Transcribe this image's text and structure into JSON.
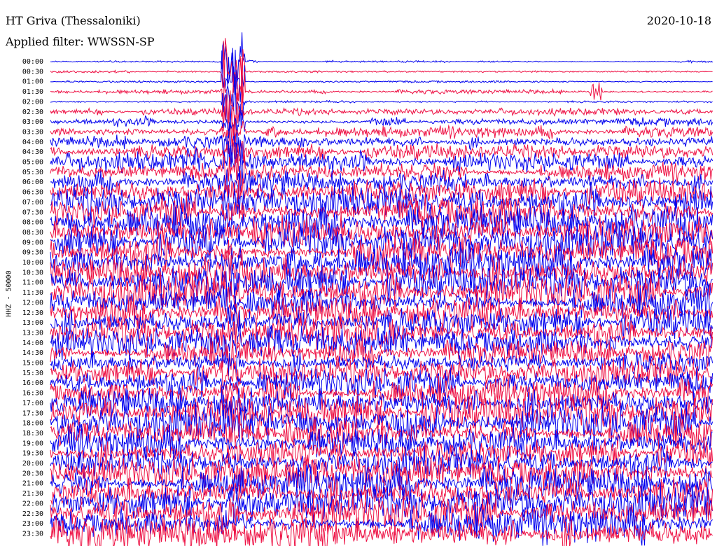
{
  "header": {
    "station": "HT Griva (Thessaloniki)",
    "date": "2020-10-18",
    "filter": "Applied filter: WWSSN-SP"
  },
  "chart_data": {
    "type": "line",
    "title": "HT Griva (Thessaloniki)",
    "ylabel": "HHZ - 50000",
    "colors": [
      "#0000ee",
      "#ee1144"
    ],
    "categories": [
      "00:00",
      "00:30",
      "01:00",
      "01:30",
      "02:00",
      "02:30",
      "03:00",
      "03:30",
      "04:00",
      "04:30",
      "05:00",
      "05:30",
      "06:00",
      "06:30",
      "07:00",
      "07:30",
      "08:00",
      "08:30",
      "09:00",
      "09:30",
      "10:00",
      "10:30",
      "11:00",
      "11:30",
      "12:00",
      "12:30",
      "13:00",
      "13:30",
      "14:00",
      "14:30",
      "15:00",
      "15:30",
      "16:00",
      "16:30",
      "17:00",
      "17:30",
      "18:00",
      "18:30",
      "19:00",
      "19:30",
      "20:00",
      "20:30",
      "21:00",
      "21:30",
      "22:00",
      "22:30",
      "23:00",
      "23:30"
    ],
    "values": [
      1,
      1,
      1,
      2,
      1,
      3,
      4,
      5,
      6,
      7,
      8,
      8,
      9,
      12,
      14,
      16,
      16,
      16,
      16,
      16,
      16,
      16,
      16,
      16,
      15,
      15,
      14,
      13,
      13,
      12,
      11,
      12,
      13,
      14,
      15,
      16,
      16,
      16,
      14,
      13,
      13,
      14,
      15,
      16,
      16,
      16,
      16,
      16
    ]
  }
}
